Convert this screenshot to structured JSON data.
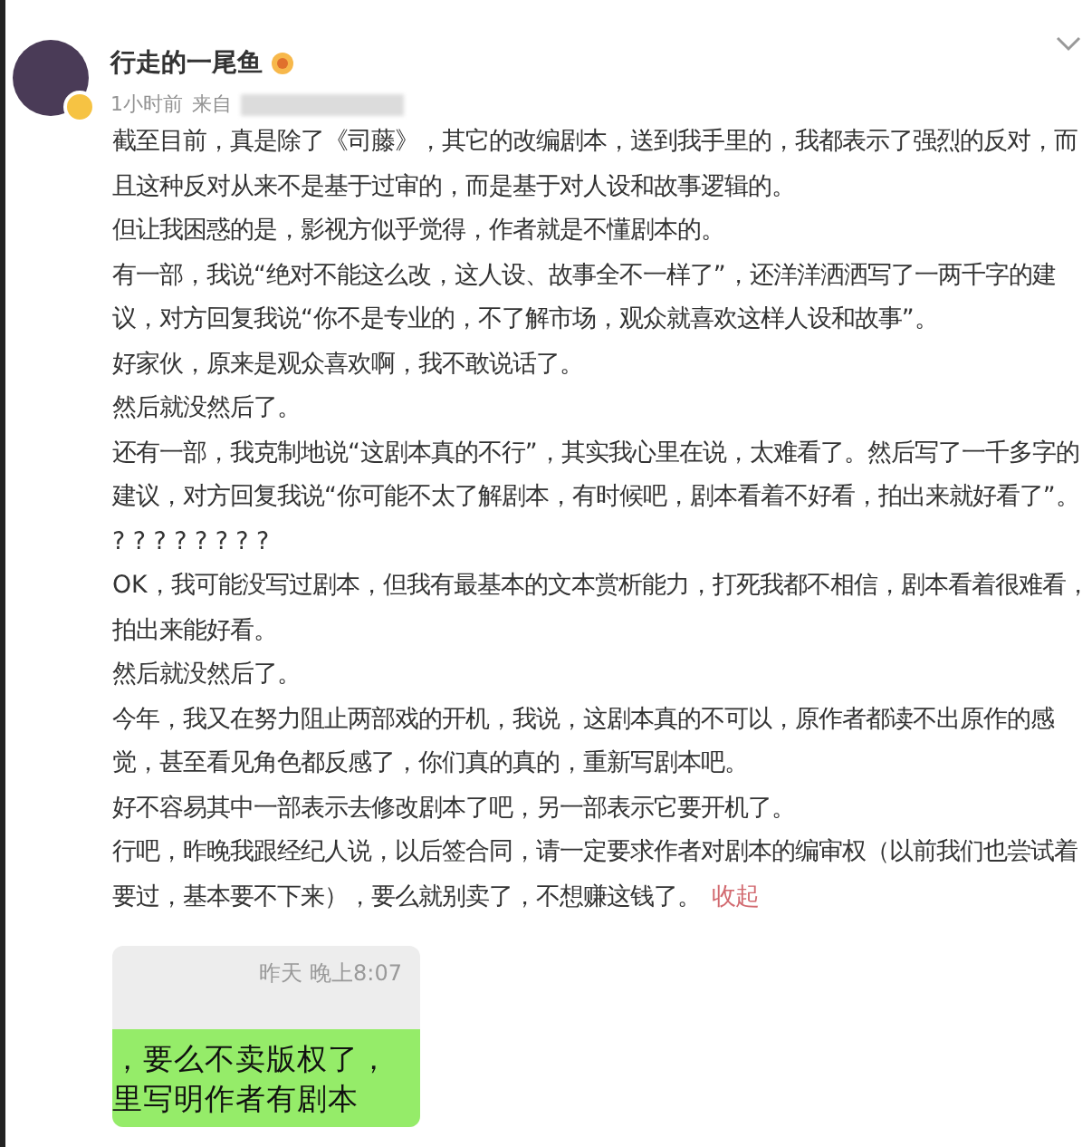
{
  "author": {
    "name": "行走的一尾鱼",
    "verified": true
  },
  "meta": {
    "time": "1小时前",
    "source_label": "来自"
  },
  "paragraphs": [
    "截至目前，真是除了《司藤》，其它的改编剧本，送到我手里的，我都表示了强烈的反对，而且这种反对从来不是基于过审的，而是基于对人设和故事逻辑的。",
    "但让我困惑的是，影视方似乎觉得，作者就是不懂剧本的。",
    "有一部，我说“绝对不能这么改，这人设、故事全不一样了”，还洋洋洒洒写了一两千字的建议，对方回复我说“你不是专业的，不了解市场，观众就喜欢这样人设和故事”。",
    "好家伙，原来是观众喜欢啊，我不敢说话了。",
    "然后就没然后了。",
    "还有一部，我克制地说“这剧本真的不行”，其实我心里在说，太难看了。然后写了一千多字的建议，对方回复我说“你可能不太了解剧本，有时候吧，剧本看着不好看，拍出来就好看了”。",
    "? ? ? ? ? ? ? ?",
    "OK，我可能没写过剧本，但我有最基本的文本赏析能力，打死我都不相信，剧本看着很难看，拍出来能好看。",
    "然后就没然后了。",
    "今年，我又在努力阻止两部戏的开机，我说，这剧本真的不可以，原作者都读不出原作的感觉，甚至看见角色都反感了，你们真的真的，重新写剧本吧。",
    "好不容易其中一部表示去修改剧本了吧，另一部表示它要开机了。",
    "行吧，昨晚我跟经纪人说，以后签合同，请一定要求作者对剧本的编审权（以前我们也尝试着要过，基本要不下来），要么就别卖了，不想赚这钱了。"
  ],
  "collapse_link": "收起",
  "chat_screenshot": {
    "timestamp": "昨天 晚上8:07",
    "bubble_lines": [
      "，要么不卖版权了，",
      "里写明作者有剧本"
    ]
  }
}
